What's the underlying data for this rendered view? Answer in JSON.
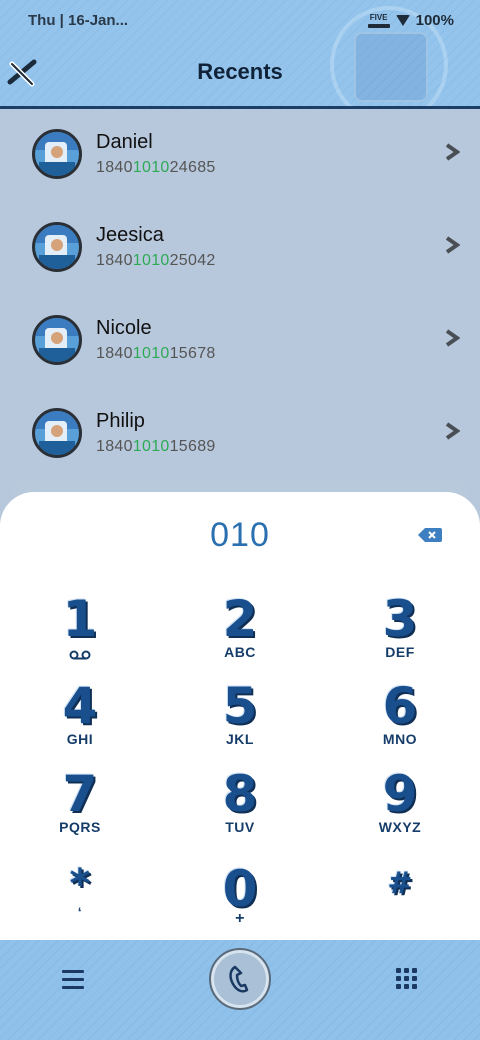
{
  "status": {
    "time": "Thu | 16-Jan...",
    "network": "FIVE",
    "battery": "100%"
  },
  "header": {
    "title": "Recents"
  },
  "recents": [
    {
      "name": "Daniel",
      "number_pre": "1840",
      "number_match": "1010",
      "number_post": "24685"
    },
    {
      "name": "Jeesica",
      "number_pre": "1840",
      "number_match": "1010",
      "number_post": "25042"
    },
    {
      "name": "Nicole",
      "number_pre": "1840",
      "number_match": "1010",
      "number_post": "15678"
    },
    {
      "name": "Philip",
      "number_pre": "1840",
      "number_match": "1010",
      "number_post": "15689"
    }
  ],
  "dialer": {
    "input": "010",
    "keys": [
      {
        "digit": "1",
        "letters": ""
      },
      {
        "digit": "2",
        "letters": "ABC"
      },
      {
        "digit": "3",
        "letters": "DEF"
      },
      {
        "digit": "4",
        "letters": "GHI"
      },
      {
        "digit": "5",
        "letters": "JKL"
      },
      {
        "digit": "6",
        "letters": "MNO"
      },
      {
        "digit": "7",
        "letters": "PQRS"
      },
      {
        "digit": "8",
        "letters": "TUV"
      },
      {
        "digit": "9",
        "letters": "WXYZ"
      },
      {
        "digit": "*",
        "letters": "‘"
      },
      {
        "digit": "0",
        "letters": "+"
      },
      {
        "digit": "#",
        "letters": ""
      }
    ]
  },
  "colors": {
    "accent": "#2a6fb0",
    "match": "#2eaa55",
    "navy": "#1a4f8e"
  },
  "icons": [
    "logo-icon",
    "chevron-right-icon",
    "backspace-icon",
    "voicemail-icon",
    "menu-icon",
    "phone-icon",
    "dialpad-grid-icon"
  ]
}
